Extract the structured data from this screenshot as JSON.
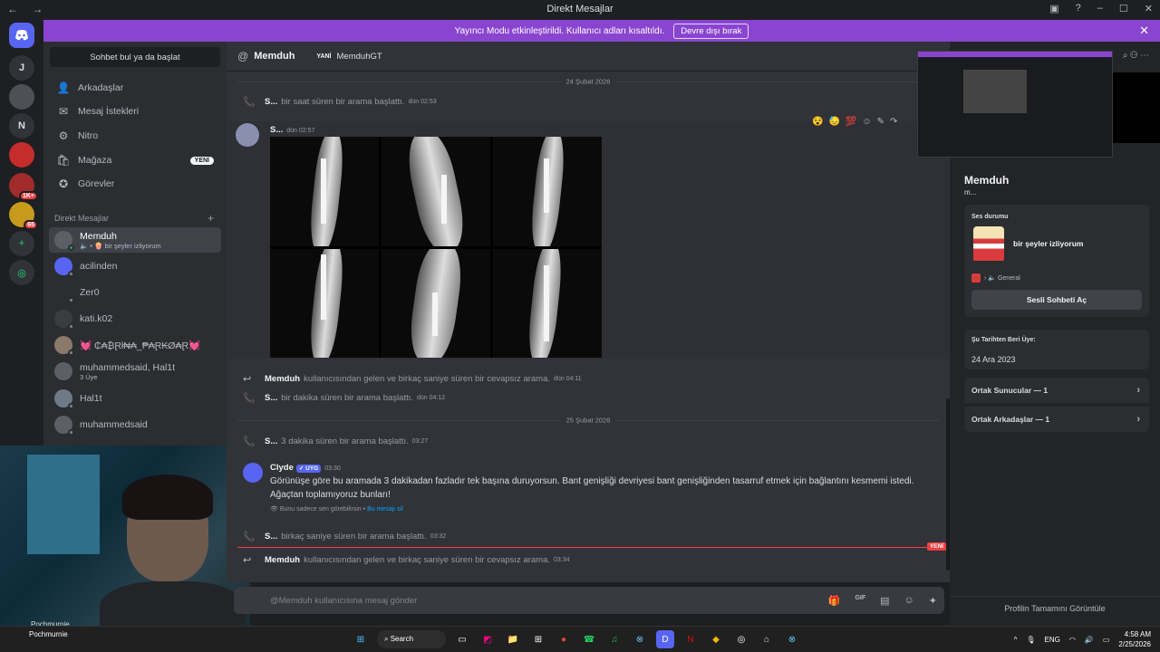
{
  "window": {
    "title": "Direkt Mesajlar",
    "nav": "← →",
    "controls": [
      "▣",
      "?",
      "–",
      "☐",
      "✕"
    ]
  },
  "banner": {
    "text": "Yayıncı Modu etkinleştirildi. Kullanıcı adları kısaltıldı.",
    "button": "Devre dışı bırak",
    "close": "✕"
  },
  "servers": [
    {
      "label": "",
      "icon": "discord-icon",
      "color": "#5865f2"
    },
    {
      "label": "J",
      "color": "#313338"
    },
    {
      "label": "",
      "color": "#4e5058"
    },
    {
      "label": "N",
      "color": "#313338"
    },
    {
      "label": "",
      "color": "#c72c2c"
    },
    {
      "label": "",
      "color": "#a02b2b",
      "badge": "1K+"
    },
    {
      "label": "",
      "color": "#c69b1c",
      "badge": "65"
    },
    {
      "label": "+",
      "color": "#313338"
    },
    {
      "label": "◎",
      "color": "#313338"
    }
  ],
  "dm_panel": {
    "search": "Sohbet bul ya da başlat",
    "nav": [
      {
        "label": "Arkadaşlar",
        "icon": "friends-icon",
        "glyph": "👤"
      },
      {
        "label": "Mesaj İstekleri",
        "icon": "mail-icon",
        "glyph": "✉"
      },
      {
        "label": "Nitro",
        "icon": "nitro-icon",
        "glyph": "⚙"
      },
      {
        "label": "Mağaza",
        "icon": "shop-icon",
        "glyph": "🛍",
        "badge": "YENİ"
      },
      {
        "label": "Görevler",
        "icon": "quests-icon",
        "glyph": "✪"
      }
    ],
    "section": "Direkt Mesajlar",
    "section_add": "+",
    "items": [
      {
        "name": "Memduh",
        "sub": "🔈 • 🍿 bir şeyler izliyorum",
        "selected": true
      },
      {
        "name": "acilinden",
        "sub": ""
      },
      {
        "name": "Zer0",
        "sub": ""
      },
      {
        "name": "kati.k02",
        "sub": ""
      },
      {
        "name": "💓 ₵₳₿Ɽł₦₳_₱₳Ɽ₭Ø₳Ɽ💓",
        "sub": ""
      },
      {
        "name": "muhammedsaid, Hal1t",
        "sub": "3 Üye"
      },
      {
        "name": "Hal1t",
        "sub": ""
      },
      {
        "name": "muhammedsaid",
        "sub": ""
      }
    ]
  },
  "webcam": {
    "label": "Pochmurnie"
  },
  "chat_header": {
    "icon": "@",
    "name": "Memduh",
    "tag": "YANİ",
    "user": "MemduhGT"
  },
  "chat": {
    "date1": "24 Şubat 2026",
    "call1": {
      "who": "S...",
      "text": "bir saat süren bir arama başlattı.",
      "time": "dün 02:53"
    },
    "msg": {
      "author": "S...",
      "time": "dün 02:57"
    },
    "reactions": [
      "😵",
      "😓",
      "💯",
      "☺",
      "✎",
      "↷"
    ],
    "call2": {
      "who": "Memduh",
      "text": "kullanıcısından gelen ve birkaç saniye süren bir cevapsız arama.",
      "time": "dün 04:11"
    },
    "call3": {
      "who": "S...",
      "text": "bir dakika süren bir arama başlattı.",
      "time": "dün 04:12"
    },
    "date2": "25 Şubat 2026",
    "call4": {
      "who": "S...",
      "text": "3 dakika süren bir arama başlattı.",
      "time": "03:27"
    },
    "clyde": {
      "author": "Clyde",
      "bot": "✓ UYG",
      "time": "03:30",
      "text": "Görünüşe göre bu aramada 3 dakikadan fazladır tek başına duruyorsun. Bant genişliği devriyesi bant genişliğinden tasarruf etmek için bağlantını kesmemi istedi. Ağaçtan toplamıyoruz bunları!",
      "ephemeral": "Bunu sadece sen görebilirsin •",
      "delete": "Bu mesajı sil"
    },
    "call5": {
      "who": "S...",
      "text": "birkaç saniye süren bir arama başlattı.",
      "time": "03:32"
    },
    "new_label": "YENİ",
    "call6": {
      "who": "Memduh",
      "text": "kullanıcısından gelen ve birkaç saniye süren bir cevapsız arama.",
      "time": "03:34"
    }
  },
  "composer": {
    "placeholder": "@Memduh kullanıcısına mesaj gönder",
    "tools": [
      "🎁",
      "GIF",
      "▤",
      "☺",
      "✦"
    ]
  },
  "profile": {
    "name": "Memduh",
    "sub": "m...",
    "voice_title": "Ses durumu",
    "activity": "bir şeyler izliyorum",
    "channel": "🔈 General",
    "channel_arrow": "›",
    "voice_button": "Sesli Sohbeti Aç",
    "since_title": "Şu Tarihten Beri Üye:",
    "since": "24 Ara 2023",
    "mutual_servers": "Ortak Sunucular — 1",
    "mutual_friends": "Ortak Arkadaşlar — 1",
    "full": "Profilin Tamamını Görüntüle",
    "chevron": "›",
    "header_icons": "⌕ ⚇ ⋯"
  },
  "taskbar": {
    "weather": "Pochmurnie",
    "search": "⌕ Search",
    "lang": "ENG",
    "time": "4:58 AM",
    "date": "2/25/2026",
    "tray": [
      "^",
      "🎙"
    ],
    "apps": [
      "⊞",
      "▭",
      "◩",
      "📁",
      "⊞",
      "●",
      "☎",
      "♫",
      "⊗",
      "D",
      "N",
      "◆",
      "◎",
      "⌂",
      "⊗"
    ]
  },
  "colors": {
    "accent": "#5865f2",
    "banner": "#8a45d0",
    "online": "#23a559",
    "danger": "#f23f43"
  }
}
